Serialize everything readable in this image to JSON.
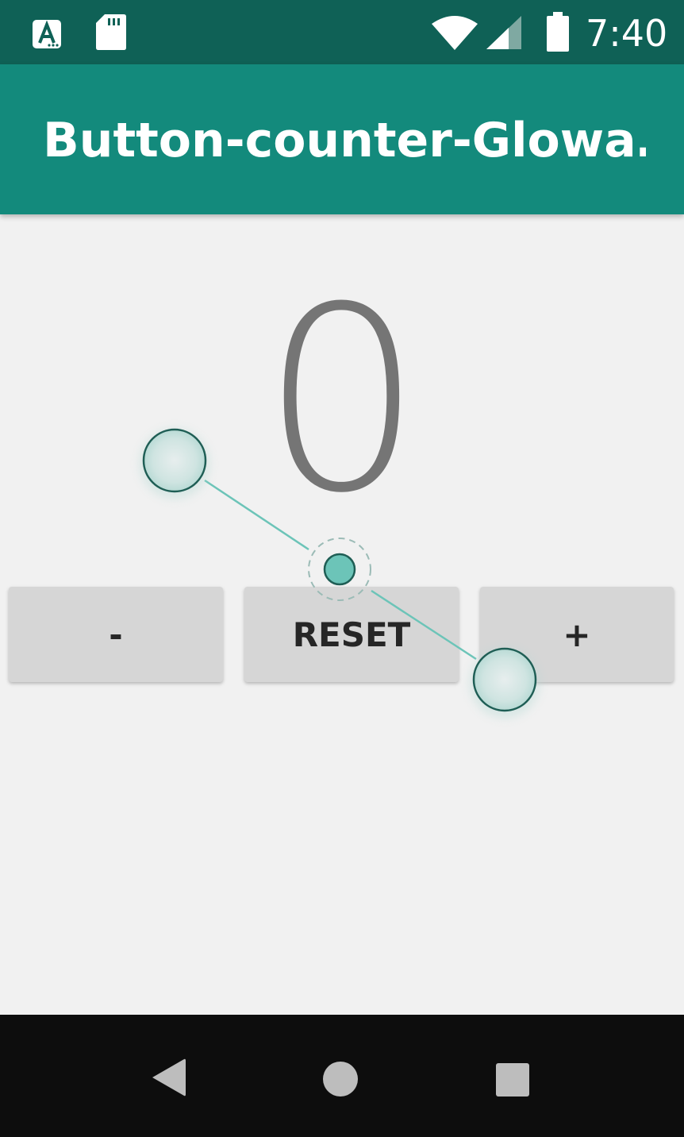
{
  "status_bar": {
    "time": "7:40",
    "icons": [
      "notification-a-icon",
      "sd-card-icon",
      "wifi-icon",
      "signal-icon",
      "battery-icon"
    ]
  },
  "app_bar": {
    "title": "Button-counter-Glowa…",
    "color": "#138a7c"
  },
  "counter": {
    "value": "0"
  },
  "buttons": {
    "minus_label": "-",
    "reset_label": "RESET",
    "plus_label": "+"
  },
  "nav_bar": {
    "icons": [
      "back-icon",
      "home-icon",
      "recents-icon"
    ]
  },
  "colors": {
    "status_bar": "#0f6156",
    "accent": "#138a7c",
    "background": "#f1f1f1",
    "button": "#d6d6d6",
    "counter_text": "#757575"
  }
}
